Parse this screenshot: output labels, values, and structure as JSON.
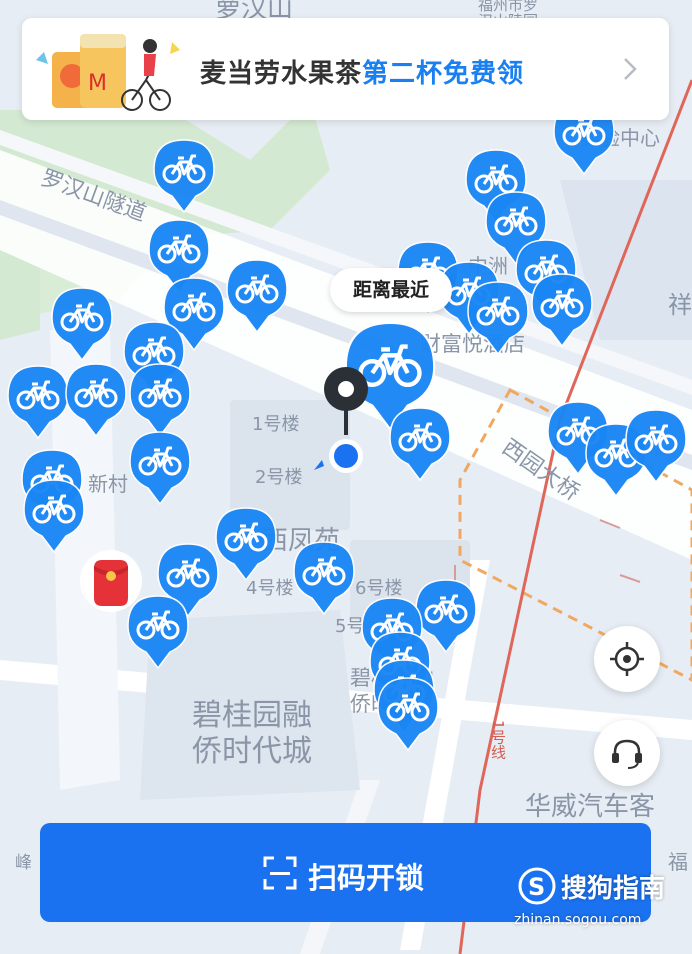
{
  "map": {
    "labels": {
      "top_partial": "萝汉山",
      "top_metro": "福州市罗",
      "top_metro2": "汉山陵园",
      "tunnel": "罗汉山隧道",
      "lab_center": "实验中心",
      "zhongzhou": "中洲",
      "hotel": "财富悦酒店",
      "bldg1": "1号楼",
      "bldg2": "2号楼",
      "xincun": "新村",
      "xifengyuan": "西凤苑",
      "bldg4": "4号楼",
      "bldg6": "6号楼",
      "bldg5": "5号",
      "bgy_line1": "碧桂园融",
      "bgy_line2": "侨时代城",
      "bgy_small1": "碧桂园融",
      "bgy_small2": "侨时代城",
      "bridge": "西园大桥",
      "line1": "1号线",
      "huawei": "华威汽车客",
      "peak": "峰",
      "fu": "福",
      "xiang": "祥"
    }
  },
  "banner": {
    "text_main": "麦当劳水果茶",
    "text_highlight": "第二杯免费领"
  },
  "tooltip": {
    "nearest": "距离最近"
  },
  "scan": {
    "label": "扫码开锁"
  },
  "watermark": {
    "brand": "搜狗指南",
    "url": "zhinan.sogou.com"
  },
  "colors": {
    "accent": "#1a72f0",
    "pin": "#1a86f4",
    "highlight": "#1a7ff0"
  }
}
